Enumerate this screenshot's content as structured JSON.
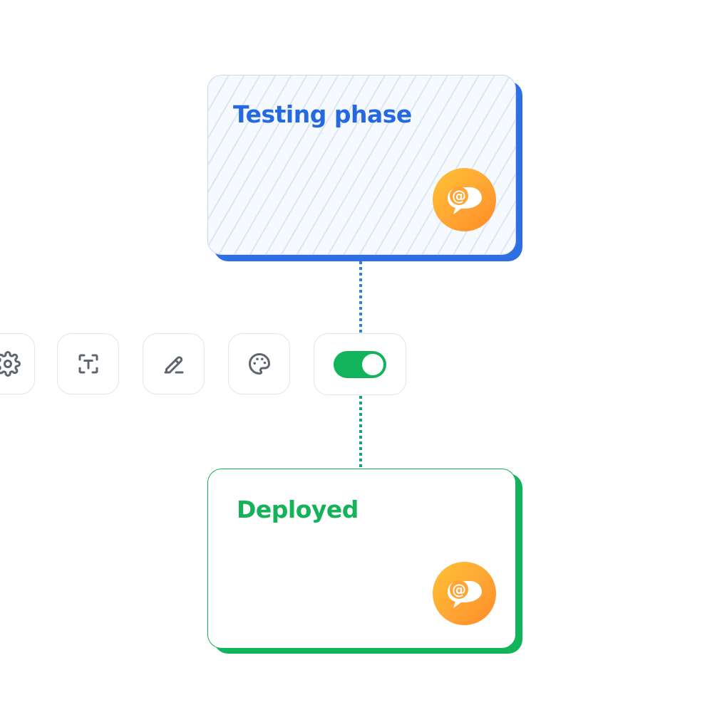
{
  "flow": {
    "nodes": [
      {
        "title": "Testing phase",
        "accent_color": "#2f6fe4",
        "title_color": "#2469e0",
        "icon": "chat-mention-icon"
      },
      {
        "title": "Deployed",
        "accent_color": "#11b45a",
        "title_color": "#14b35a",
        "icon": "chat-mention-icon"
      }
    ],
    "connector_colors": [
      "#2b85d6",
      "#16a085"
    ]
  },
  "toolbar": {
    "buttons": [
      {
        "icon": "gear-icon"
      },
      {
        "icon": "text-frame-icon"
      },
      {
        "icon": "pencil-icon"
      },
      {
        "icon": "palette-icon"
      }
    ],
    "toggle": {
      "state": "on",
      "color": "#11b45a"
    }
  },
  "badge_gradient": [
    "#ffc233",
    "#ff8a24"
  ]
}
